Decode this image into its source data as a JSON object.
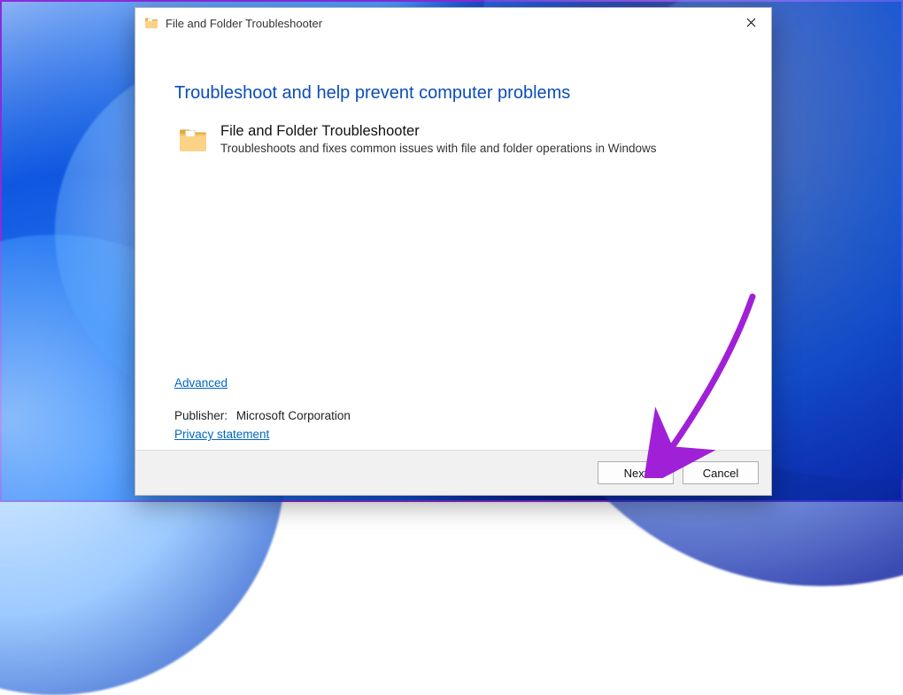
{
  "window": {
    "title": "File and Folder Troubleshooter"
  },
  "main": {
    "headline": "Troubleshoot and help prevent computer problems",
    "item": {
      "title": "File and Folder Troubleshooter",
      "description": "Troubleshoots and fixes common issues with file and folder operations in Windows"
    },
    "advanced_link": "Advanced",
    "publisher_label": "Publisher:",
    "publisher_value": "Microsoft Corporation",
    "privacy_link": "Privacy statement"
  },
  "footer": {
    "next": "Next",
    "cancel": "Cancel"
  },
  "icons": {
    "close": "close-icon",
    "folder": "folder-icon"
  },
  "colors": {
    "link": "#0067c0",
    "headline": "#0b4db5",
    "annotation": "#a020d8"
  }
}
